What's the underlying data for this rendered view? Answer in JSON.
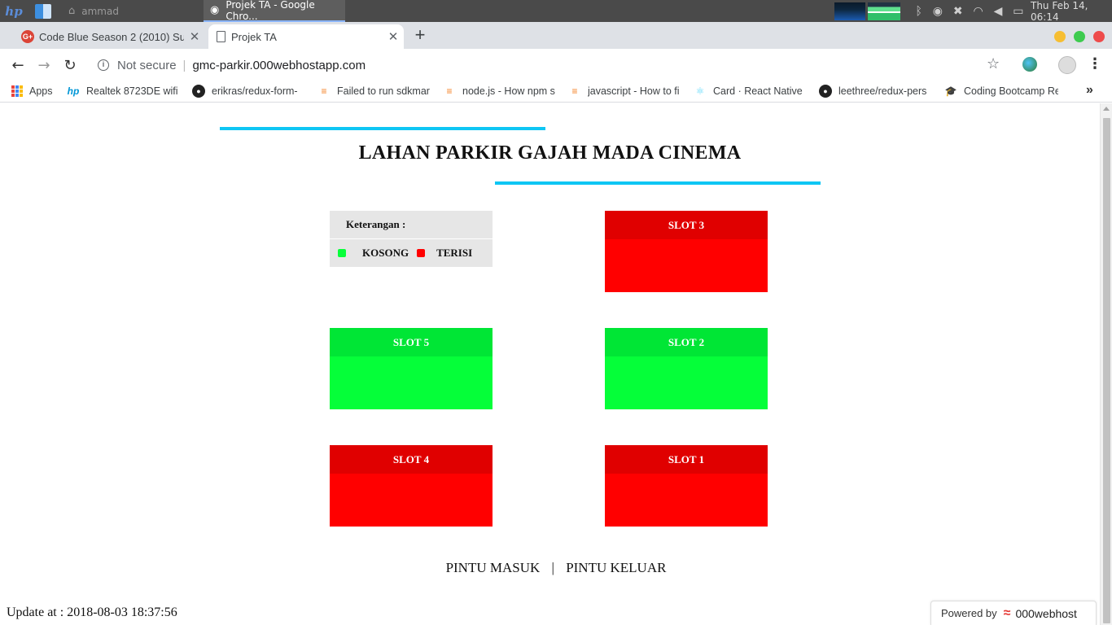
{
  "taskbar": {
    "windows": [
      {
        "label": "ammad",
        "icon": "home-icon"
      },
      {
        "label": "Projek TA - Google Chro...",
        "icon": "chrome-icon"
      }
    ],
    "clock": "Thu Feb 14, 06:14"
  },
  "browser": {
    "tabs": [
      {
        "title": "Code Blue Season 2 (2010) Sub",
        "icon": "google-plus-icon",
        "active": false
      },
      {
        "title": "Projek TA",
        "icon": "page-icon",
        "active": true
      }
    ],
    "security_label": "Not secure",
    "url": "gmc-parkir.000webhostapp.com",
    "bookmarks": [
      {
        "label": "Apps",
        "icon": "apps-icon"
      },
      {
        "label": "Realtek 8723DE wifi",
        "icon": "hp-icon"
      },
      {
        "label": "erikras/redux-form-",
        "icon": "github-icon"
      },
      {
        "label": "Failed to run sdkmar",
        "icon": "stackoverflow-icon"
      },
      {
        "label": "node.js - How npm s",
        "icon": "stackoverflow-icon"
      },
      {
        "label": "javascript - How to fi",
        "icon": "stackoverflow-icon"
      },
      {
        "label": "Card · React Native E",
        "icon": "react-icon"
      },
      {
        "label": "leethree/redux-pers",
        "icon": "github-icon"
      },
      {
        "label": "Coding Bootcamp Re",
        "icon": "graduation-cap-icon"
      }
    ]
  },
  "page": {
    "title": "LAHAN PARKIR GAJAH MADA CINEMA",
    "legend": {
      "heading": "Keterangan :",
      "empty_label": "KOSONG",
      "filled_label": "TERISI"
    },
    "slots": {
      "slot3": {
        "label": "SLOT 3",
        "status": "terisi"
      },
      "slot5": {
        "label": "SLOT 5",
        "status": "kosong"
      },
      "slot2": {
        "label": "SLOT 2",
        "status": "kosong"
      },
      "slot4": {
        "label": "SLOT 4",
        "status": "terisi"
      },
      "slot1": {
        "label": "SLOT 1",
        "status": "terisi"
      }
    },
    "gates": {
      "entry": "PINTU MASUK",
      "separator": "|",
      "exit": "PINTU KELUAR"
    },
    "update": "Update at : 2018-08-03 18:37:56",
    "powered_by": {
      "prefix": "Powered by",
      "brand": "000webhost"
    }
  },
  "colors": {
    "accent_line": "#0ec6f4",
    "empty": "#05ff39",
    "filled": "#ff0000"
  }
}
